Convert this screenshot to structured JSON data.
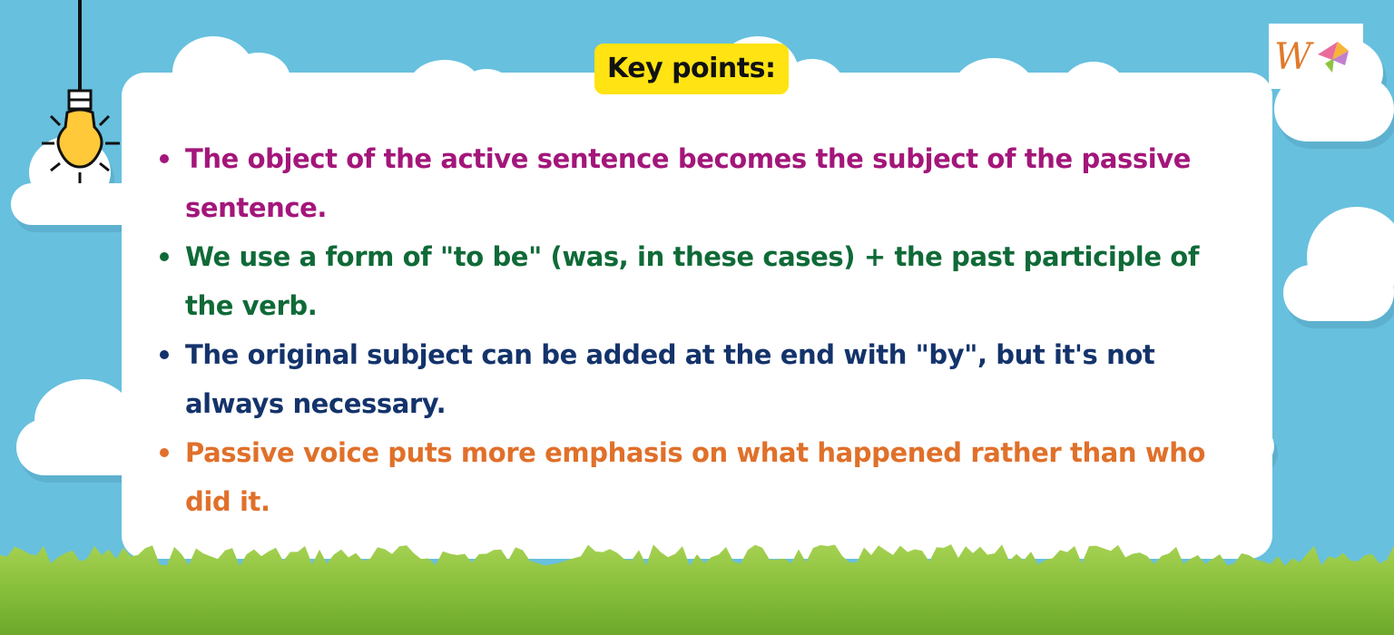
{
  "title": "Key points:",
  "points": [
    {
      "text": "The object of the active sentence becomes the subject of the passive sentence.",
      "color": "#a3167a"
    },
    {
      "text": "We use a form of \"to be\" (was, in these cases) + the past participle of the verb.",
      "color": "#0f6a37"
    },
    {
      "text": "The original subject can be added at the end with \"by\", but it's not always necessary.",
      "color": "#14336b"
    },
    {
      "text": "Passive voice puts more emphasis on what happened rather than who did it.",
      "color": "#e0702a"
    }
  ],
  "colors": {
    "sky": "#67c0de",
    "badge": "#ffe312",
    "grass": "#8cc63f"
  },
  "icons": [
    "light-bulb-icon",
    "logo-icon"
  ]
}
